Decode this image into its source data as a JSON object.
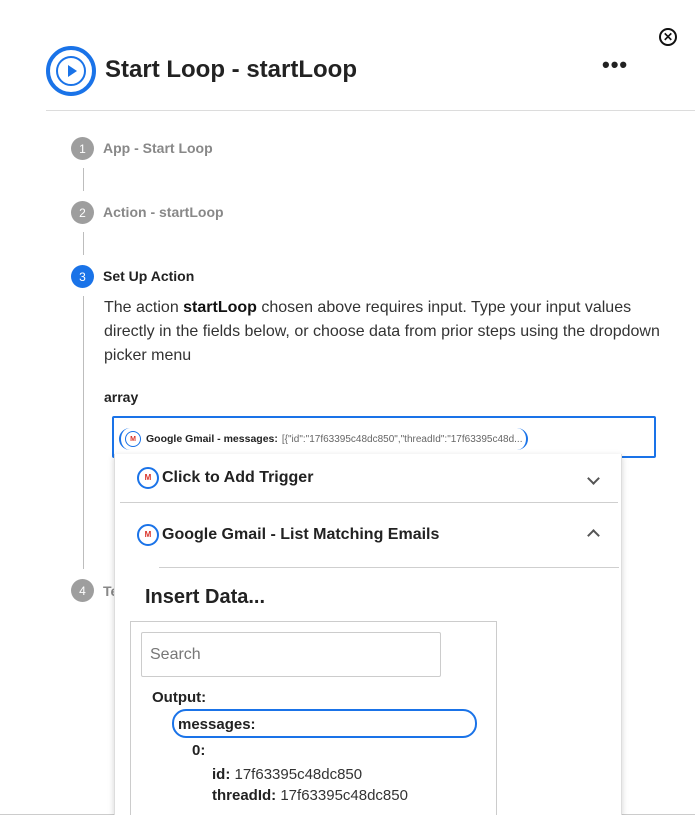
{
  "header": {
    "title": "Start Loop - startLoop",
    "more_label": "•••",
    "close_label": "✕"
  },
  "steps": [
    {
      "num": "1",
      "label": "App - Start Loop"
    },
    {
      "num": "2",
      "label": "Action - startLoop"
    },
    {
      "num": "3",
      "label": "Set Up Action"
    },
    {
      "num": "4",
      "label": "Te"
    }
  ],
  "setup": {
    "desc_before": "The action ",
    "desc_bold": "startLoop",
    "desc_after": " chosen above requires input. Type your input values directly in the fields below, or choose data from prior steps using the dropdown picker menu",
    "field_label": "array",
    "pill_label": "Google Gmail - messages:",
    "pill_value": "[{\"id\":\"17f63395c48dc850\",\"threadId\":\"17f63395c48d..."
  },
  "dropdown": {
    "trigger_label": "Click to Add Trigger",
    "source_label": "Google Gmail - List Matching Emails",
    "insert_title": "Insert Data...",
    "search_placeholder": "Search",
    "tree": {
      "output": "Output:",
      "messages": "messages:",
      "index": "0:",
      "id_key": "id:",
      "id_value": "17f63395c48dc850",
      "thread_key": "threadId:",
      "thread_value": "17f63395c48dc850"
    }
  },
  "colors": {
    "accent": "#1a73e8",
    "step_inactive": "#9e9e9e",
    "gmail_red": "#d93025"
  },
  "icons": {
    "app": "start-loop-icon",
    "gmail": "gmail-icon",
    "close": "close-icon",
    "more": "more-icon"
  }
}
